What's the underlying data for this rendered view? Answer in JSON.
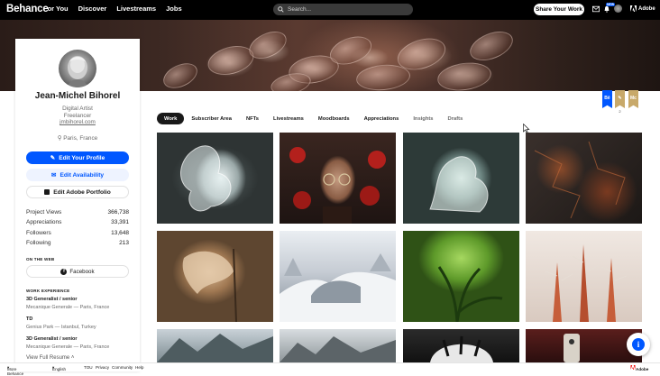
{
  "nav": {
    "logo": "Behance",
    "links": [
      "For You",
      "Discover",
      "Livestreams",
      "Jobs"
    ],
    "search_placeholder": "Search...",
    "share_button": "Share Your Work",
    "nft_badge": "NEW",
    "adobe_label": "Adobe"
  },
  "profile": {
    "name": "Jean-Michel Bihorel",
    "occupation": "Digital Artist",
    "status": "Freelancer",
    "website": "jmbihorel.com",
    "location": "Paris, France",
    "buttons": {
      "edit_profile": "Edit Your Profile",
      "edit_availability": "Edit Availability",
      "edit_portfolio": "Edit Adobe Portfolio"
    },
    "stats": [
      {
        "label": "Project Views",
        "value": "366,738"
      },
      {
        "label": "Appreciations",
        "value": "33,391"
      },
      {
        "label": "Followers",
        "value": "13,648"
      },
      {
        "label": "Following",
        "value": "213"
      }
    ],
    "on_the_web_title": "ON THE WEB",
    "facebook_label": "Facebook",
    "work_experience_title": "WORK EXPERIENCE",
    "experience": [
      {
        "title": "3D Generalist / senior",
        "place": "Mecanique Generale — Paris, France"
      },
      {
        "title": "TD",
        "place": "Genius Park — Istanbul, Turkey"
      },
      {
        "title": "3D Generalist / senior",
        "place": "Mecanique Generale — Paris, France"
      }
    ],
    "view_resume": "View Full Resume"
  },
  "tabs": [
    "Work",
    "Subscriber Area",
    "NFTs",
    "Livestreams",
    "Moodboards",
    "Appreciations",
    "Insights",
    "Drafts"
  ],
  "active_tab": "Work",
  "badges": [
    {
      "label": "Bē",
      "count": "",
      "color": "#0057ff"
    },
    {
      "label": "✎",
      "count": "2",
      "color": "#c8a96a"
    },
    {
      "label": "Mc",
      "count": "",
      "color": "#c8a96a"
    }
  ],
  "footer": {
    "more": "More Behance",
    "language": "English",
    "links": [
      "TOU",
      "Privacy",
      "Community",
      "Help"
    ],
    "adobe": "Adobe"
  },
  "fab_icon": "info-icon"
}
